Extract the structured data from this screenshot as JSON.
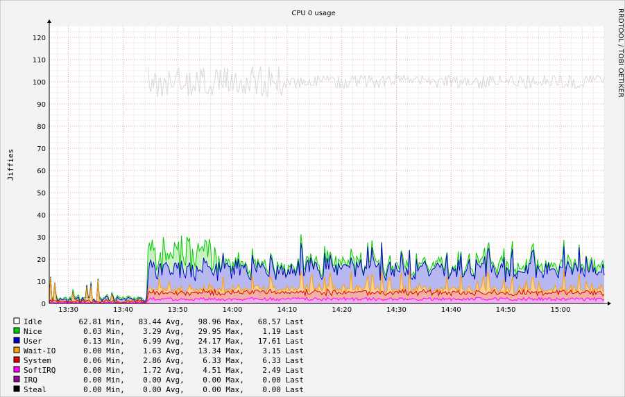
{
  "chart_data": {
    "type": "area",
    "title": "CPU 0 usage",
    "ylabel": "Jiffies",
    "watermark": "RRDTOOL / TOBI OETIKER",
    "ylim": [
      0,
      125
    ],
    "yticks": [
      "0",
      "10",
      "20",
      "30",
      "40",
      "50",
      "60",
      "70",
      "80",
      "90",
      "100",
      "110",
      "120"
    ],
    "xlim": [
      "13:26:30",
      "15:08:00"
    ],
    "xticks": [
      "13:30",
      "13:40",
      "13:50",
      "14:00",
      "14:10",
      "14:20",
      "14:30",
      "14:40",
      "14:50",
      "15:00"
    ],
    "grid": true,
    "legend_position": "bottom-left",
    "series": [
      {
        "name": "Idle",
        "color": "#e8e8e8",
        "line": "#d8d8d8",
        "min": "62.81",
        "avg": "83.44",
        "max": "98.96",
        "last": "68.57",
        "approx_level": 100
      },
      {
        "name": "Nice",
        "color": "#00cc00",
        "fill": "#c8f0c0",
        "min": "0.03",
        "avg": "3.29",
        "max": "29.95",
        "last": "1.19",
        "approx_level": 19
      },
      {
        "name": "User",
        "color": "#0000cc",
        "fill": "#b8b8f0",
        "min": "0.13",
        "avg": "6.99",
        "max": "24.17",
        "last": "17.61",
        "approx_level": 16
      },
      {
        "name": "Wait-IO",
        "color": "#ffa000",
        "fill": "#f8d0a0",
        "min": "0.00",
        "avg": "1.63",
        "max": "13.34",
        "last": "3.15",
        "approx_level": 7
      },
      {
        "name": "System",
        "color": "#dd0000",
        "fill": "#f0b0a8",
        "min": "0.06",
        "avg": "2.86",
        "max": "6.33",
        "last": "6.33",
        "approx_level": 5
      },
      {
        "name": "SoftIRQ",
        "color": "#ff00ff",
        "fill": "#f0b0f0",
        "min": "0.00",
        "avg": "1.72",
        "max": "4.51",
        "last": "2.49",
        "approx_level": 2
      },
      {
        "name": "IRQ",
        "color": "#990099",
        "min": "0.00",
        "avg": "0.00",
        "max": "0.00",
        "last": "0.00",
        "approx_level": 0
      },
      {
        "name": "Steal",
        "color": "#000000",
        "min": "0.00",
        "avg": "0.00",
        "max": "0.00",
        "last": "0.00",
        "approx_level": 0
      }
    ],
    "legend_suffixes": {
      "min": "Min,",
      "avg": "Avg,",
      "max": "Max,",
      "last": "Last"
    }
  }
}
